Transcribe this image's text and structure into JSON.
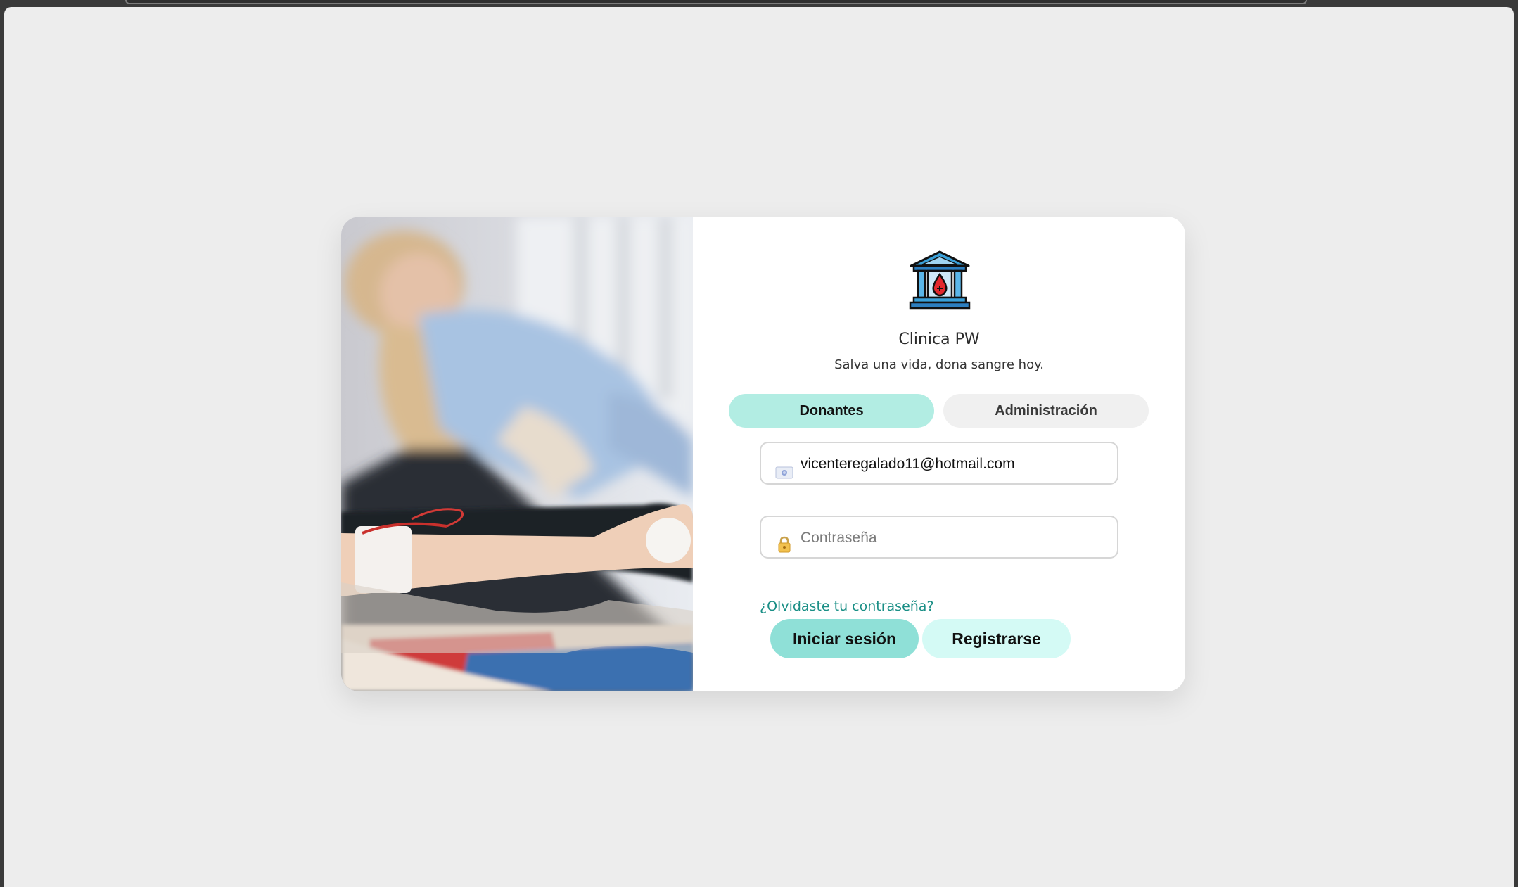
{
  "brand": {
    "name": "Clinica PW",
    "tagline": "Salva una vida, dona sangre hoy."
  },
  "tabs": {
    "donors_label": "Donantes",
    "admin_label": "Administración",
    "active": "Donantes"
  },
  "email_field": {
    "value": "vicenteregalado11@hotmail.com",
    "icon": "id-card-icon"
  },
  "password_field": {
    "placeholder": "Contraseña",
    "icon": "lock-icon"
  },
  "forgot_link": "¿Olvidaste tu contraseña?",
  "buttons": {
    "login_label": "Iniciar sesión",
    "register_label": "Registrarse"
  },
  "colors": {
    "active_tab": "#b2ede3",
    "login_button": "#8fe0d7",
    "register_button": "#d4faf5",
    "link": "#1a8f86"
  }
}
